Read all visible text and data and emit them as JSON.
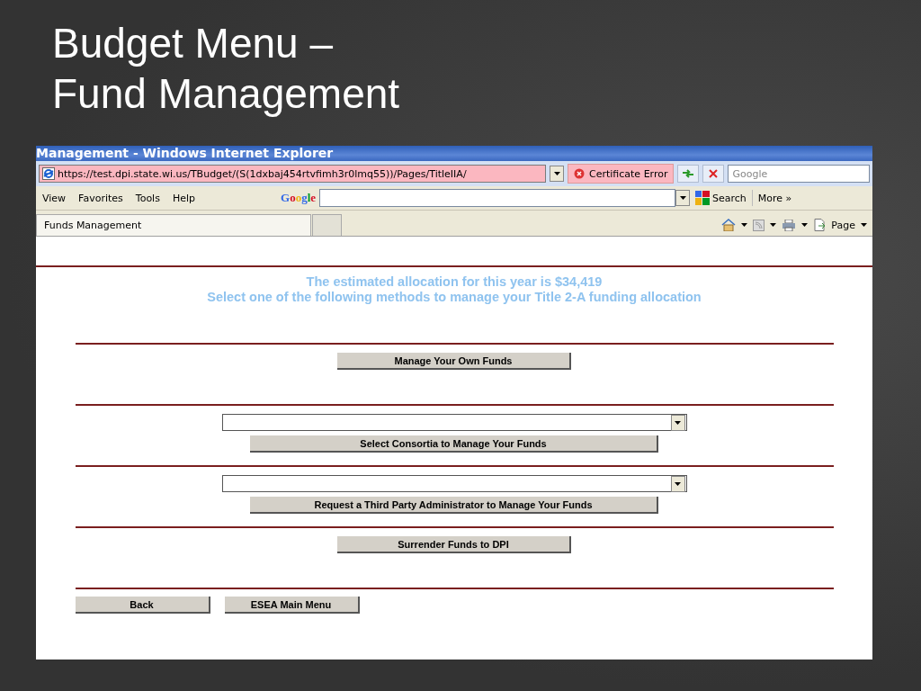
{
  "slide": {
    "title_lines": [
      "Budget Menu –",
      "Fund Management"
    ]
  },
  "browser": {
    "window_title": "Management - Windows Internet Explorer",
    "address": "https://test.dpi.state.wi.us/TBudget/(S(1dxbaj454rtvfimh3r0lmq55))/Pages/TitleIIA/",
    "certificate_error": "Certificate Error",
    "search_placeholder": "Google",
    "menu": [
      "View",
      "Favorites",
      "Tools",
      "Help"
    ],
    "google_toolbar": {
      "logo": "Google",
      "search": "Search",
      "more": "More »"
    },
    "tab": {
      "label": "Funds Management"
    },
    "command_bar": {
      "page": "Page"
    }
  },
  "page": {
    "allocation": "The estimated allocation for this year is $34,419",
    "instruction": "Select one of the following methods to manage your Title 2-A funding allocation",
    "sections": [
      {
        "kind": "button",
        "button": "Manage Your Own Funds"
      },
      {
        "kind": "select_button",
        "button": "Select Consortia to Manage Your Funds"
      },
      {
        "kind": "select_button",
        "button": "Request a Third Party Administrator to Manage Your Funds"
      },
      {
        "kind": "button",
        "button": "Surrender Funds to DPI"
      }
    ],
    "nav_buttons": [
      "Back",
      "ESEA Main Menu"
    ]
  }
}
